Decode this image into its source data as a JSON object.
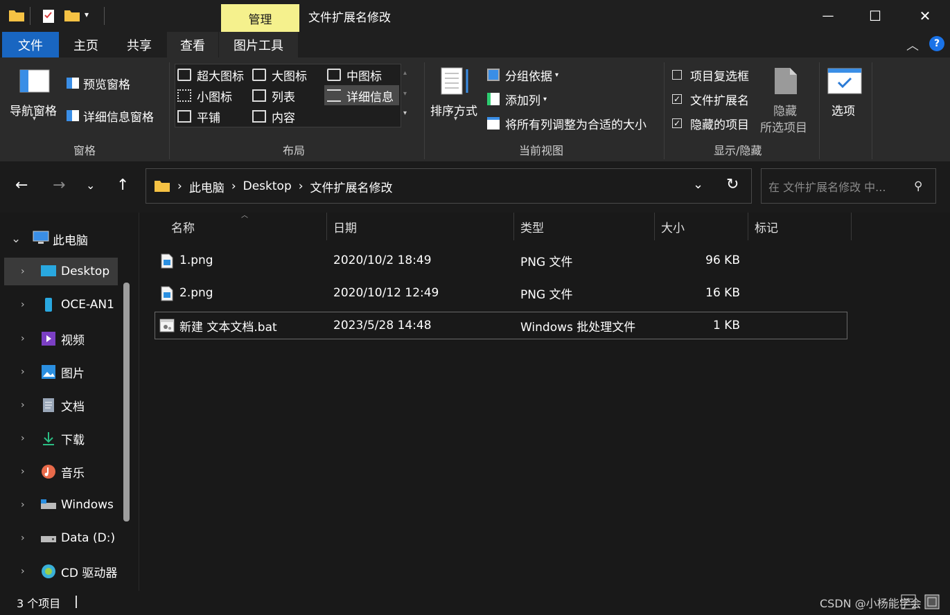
{
  "window": {
    "title": "文件扩展名修改",
    "context_tab": "管理",
    "controls": {
      "minimize": "—",
      "maximize": "☐",
      "close": "✕"
    }
  },
  "ribbon_tabs": [
    "文件",
    "主页",
    "共享",
    "查看",
    "图片工具"
  ],
  "ribbon": {
    "panes": {
      "nav_pane": "导航窗格",
      "preview_pane": "预览窗格",
      "details_pane": "详细信息窗格",
      "group_label": "窗格"
    },
    "layout": {
      "items": [
        "超大图标",
        "大图标",
        "中图标",
        "小图标",
        "列表",
        "详细信息",
        "平铺",
        "内容"
      ],
      "group_label": "布局"
    },
    "current_view": {
      "sort_by": "排序方式",
      "group_by": "分组依据",
      "add_columns": "添加列",
      "size_all_columns": "将所有列调整为合适的大小",
      "group_label": "当前视图"
    },
    "show_hide": {
      "item_checkboxes": "项目复选框",
      "item_checkboxes_checked": false,
      "file_extensions": "文件扩展名",
      "file_extensions_checked": true,
      "hidden_items": "隐藏的项目",
      "hidden_items_checked": true,
      "hide_selected_1": "隐藏",
      "hide_selected_2": "所选项目",
      "group_label": "显示/隐藏"
    },
    "options": "选项"
  },
  "navbar": {
    "breadcrumb": [
      "此电脑",
      "Desktop",
      "文件扩展名修改"
    ],
    "search_placeholder": "在 文件扩展名修改 中..."
  },
  "sidebar": {
    "items": [
      {
        "label": "此电脑",
        "icon": "computer-icon",
        "expanded": true
      },
      {
        "label": "Desktop",
        "icon": "desktop-icon"
      },
      {
        "label": "OCE-AN1",
        "icon": "phone-icon"
      },
      {
        "label": "视频",
        "icon": "video-icon"
      },
      {
        "label": "图片",
        "icon": "pictures-icon"
      },
      {
        "label": "文档",
        "icon": "documents-icon"
      },
      {
        "label": "下载",
        "icon": "download-icon"
      },
      {
        "label": "音乐",
        "icon": "music-icon"
      },
      {
        "label": "Windows",
        "icon": "drive-c-icon"
      },
      {
        "label": "Data (D:)",
        "icon": "drive-d-icon"
      },
      {
        "label": "CD 驱动器",
        "icon": "cd-drive-icon"
      }
    ]
  },
  "filelist": {
    "columns": [
      "名称",
      "日期",
      "类型",
      "大小",
      "标记"
    ],
    "rows": [
      {
        "name": "1.png",
        "date": "2020/10/2 18:49",
        "type": "PNG 文件",
        "size": "96 KB",
        "icon": "png-file-icon"
      },
      {
        "name": "2.png",
        "date": "2020/10/12 12:49",
        "type": "PNG 文件",
        "size": "16 KB",
        "icon": "png-file-icon"
      },
      {
        "name": "新建 文本文档.bat",
        "date": "2023/5/28 14:48",
        "type": "Windows 批处理文件",
        "size": "1 KB",
        "icon": "bat-file-icon"
      }
    ]
  },
  "status": {
    "count": "3 个项目",
    "watermark": "CSDN @小杨能学会"
  },
  "colors": {
    "accent": "#1966c1",
    "manage_tab": "#f5f18d"
  }
}
